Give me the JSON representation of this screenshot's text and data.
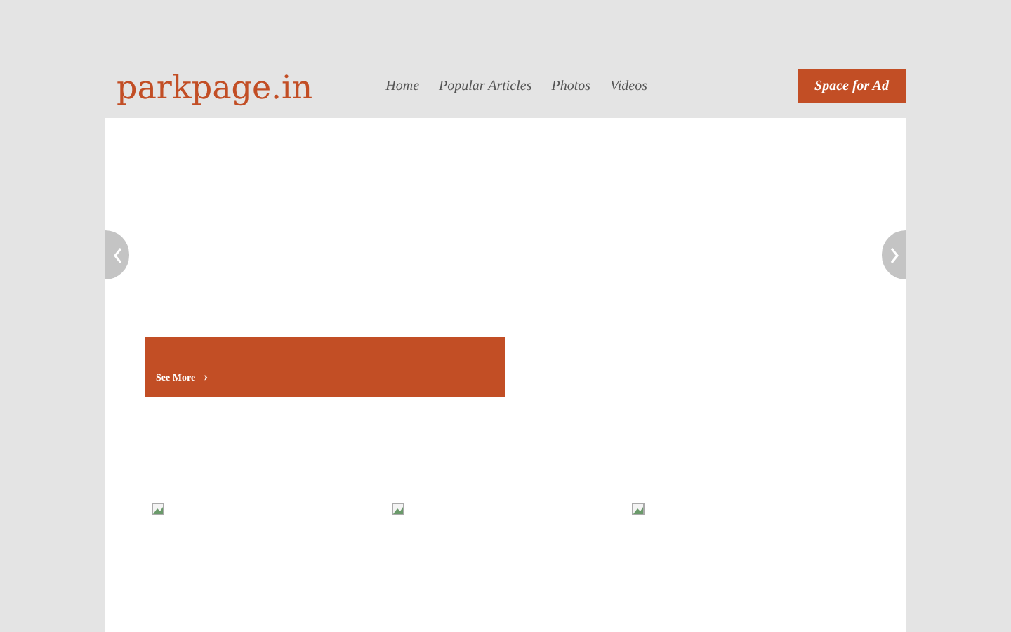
{
  "logo": "parkpage.in",
  "nav": [
    "Home",
    "Popular Articles",
    "Photos",
    "Videos"
  ],
  "ad_button": "Space for Ad",
  "slider": {
    "link": "See More",
    "link_icon": "›"
  },
  "thumbnails": [
    {
      "kind": "broken-image"
    },
    {
      "kind": "broken-image"
    },
    {
      "kind": "broken-image"
    }
  ]
}
